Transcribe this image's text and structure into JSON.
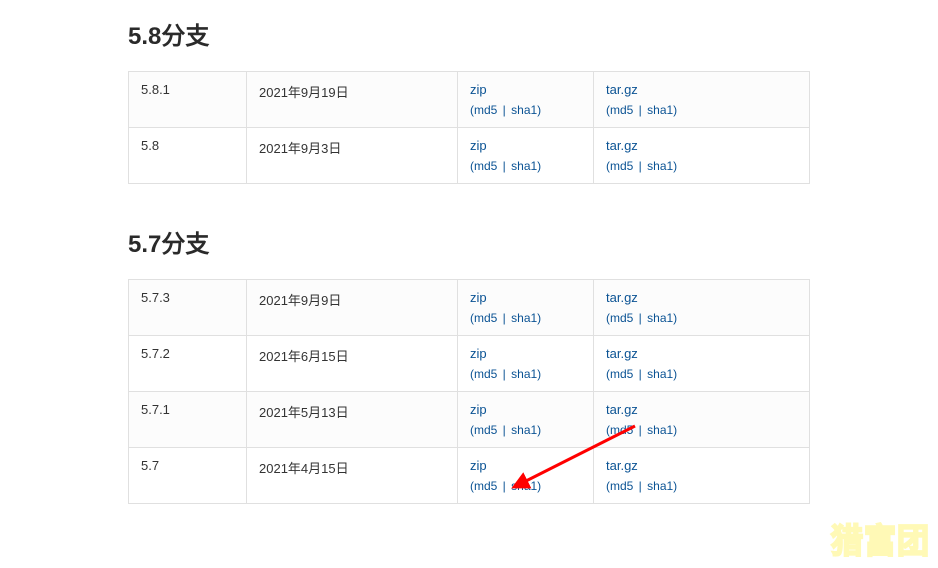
{
  "sections": [
    {
      "title": "5.8分支",
      "rows": [
        {
          "version": "5.8.1",
          "date": "2021年9月19日",
          "zip": "zip",
          "targz": "tar.gz",
          "md5": "md5",
          "sha1": "sha1"
        },
        {
          "version": "5.8",
          "date": "2021年9月3日",
          "zip": "zip",
          "targz": "tar.gz",
          "md5": "md5",
          "sha1": "sha1"
        }
      ]
    },
    {
      "title": "5.7分支",
      "rows": [
        {
          "version": "5.7.3",
          "date": "2021年9月9日",
          "zip": "zip",
          "targz": "tar.gz",
          "md5": "md5",
          "sha1": "sha1"
        },
        {
          "version": "5.7.2",
          "date": "2021年6月15日",
          "zip": "zip",
          "targz": "tar.gz",
          "md5": "md5",
          "sha1": "sha1"
        },
        {
          "version": "5.7.1",
          "date": "2021年5月13日",
          "zip": "zip",
          "targz": "tar.gz",
          "md5": "md5",
          "sha1": "sha1"
        },
        {
          "version": "5.7",
          "date": "2021年4月15日",
          "zip": "zip",
          "targz": "tar.gz",
          "md5": "md5",
          "sha1": "sha1"
        }
      ]
    }
  ],
  "watermark": "猎富团"
}
